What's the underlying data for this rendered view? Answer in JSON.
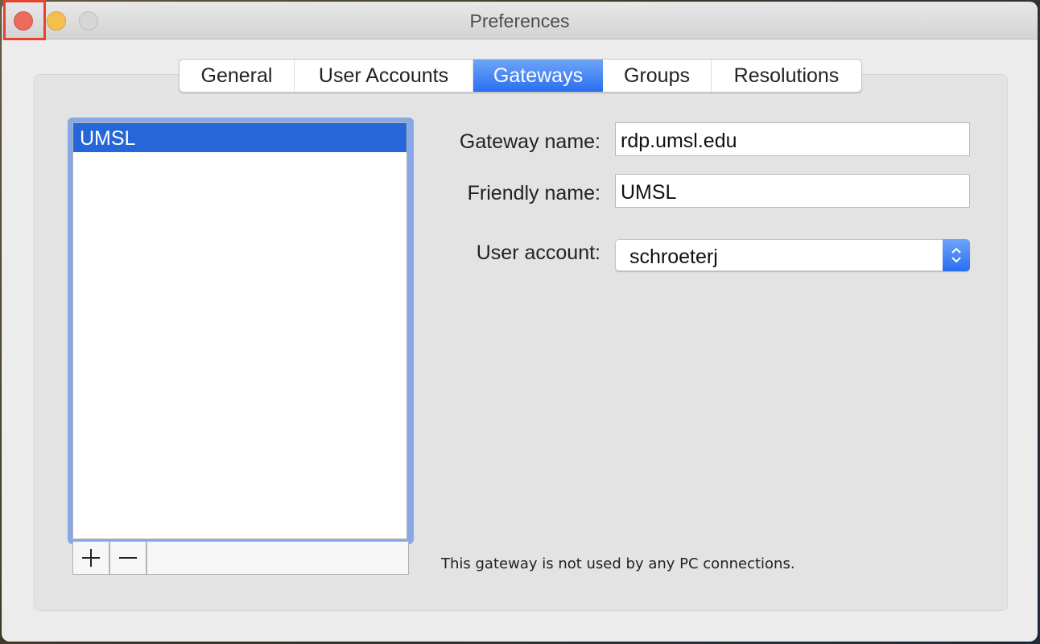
{
  "window": {
    "title": "Preferences",
    "controls": {
      "close": "close-icon",
      "minimize": "minimize-icon",
      "zoom": "zoom-icon"
    },
    "colors": {
      "close": "#ed6a5e",
      "minimize": "#f5bf4f",
      "zoom_disabled": "#d6d6d6",
      "highlight": "#e8412c",
      "accent": "#2a6ef0",
      "selection": "#2566d9"
    }
  },
  "tabs": [
    {
      "label": "General",
      "active": false
    },
    {
      "label": "User Accounts",
      "active": false
    },
    {
      "label": "Gateways",
      "active": true
    },
    {
      "label": "Groups",
      "active": false
    },
    {
      "label": "Resolutions",
      "active": false
    }
  ],
  "gateway_list": {
    "items": [
      {
        "label": "UMSL",
        "selected": true
      }
    ],
    "add_button": "+",
    "remove_button": "−"
  },
  "form": {
    "gateway_name_label": "Gateway name:",
    "gateway_name_value": "rdp.umsl.edu",
    "friendly_name_label": "Friendly name:",
    "friendly_name_value": "UMSL",
    "user_account_label": "User account:",
    "user_account_value": "schroeterj"
  },
  "status_text": "This gateway is not used by any PC connections."
}
